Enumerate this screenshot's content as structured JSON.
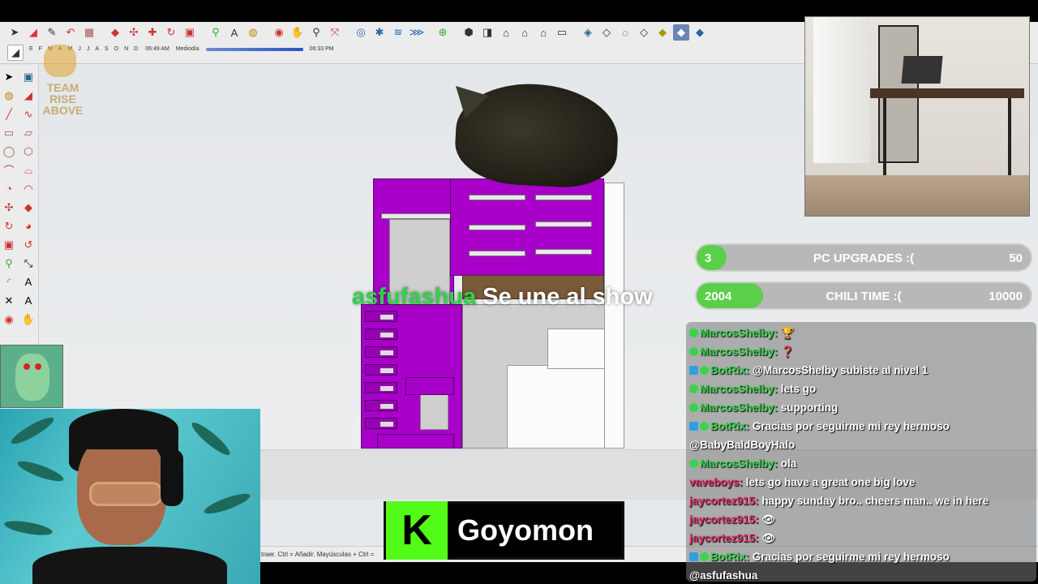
{
  "app": {
    "shadow_bar": {
      "months": [
        "E",
        "F",
        "M",
        "A",
        "M",
        "J",
        "J",
        "A",
        "S",
        "O",
        "N",
        "D"
      ],
      "time_start": "06:49 AM",
      "time_mid": "Mediodía",
      "time_end": "06:33 PM"
    },
    "status_text": "traer. Ctrl = Añadir. Mayúsculas + Ctrl =",
    "team_logo_text": "TEAM RISE ABOVE"
  },
  "overlay": {
    "join": {
      "user": "asfufashua",
      "text": " Se une al show"
    },
    "goals": [
      {
        "current": "3",
        "title": "PC UPGRADES :(",
        "target": "50",
        "progress": 0.06,
        "color": "#5bcf4a"
      },
      {
        "current": "2004",
        "title": "CHILI TIME :(",
        "target": "10000",
        "progress": 0.2,
        "color": "#5bcf4a"
      }
    ],
    "chat": [
      {
        "user": "MarcosShelby",
        "user_color": "#3bd24f",
        "text": " 🏆",
        "badges": [
          "gem"
        ]
      },
      {
        "user": "MarcosShelby",
        "user_color": "#3bd24f",
        "text": " ❓",
        "badges": [
          "gem"
        ]
      },
      {
        "user": "BotRix",
        "user_color": "#3bd24f",
        "text": " @MarcosShelby subiste al nivel 1",
        "badges": [
          "bot",
          "gem"
        ]
      },
      {
        "user": "MarcosShelby",
        "user_color": "#3bd24f",
        "text": " lets go",
        "badges": [
          "gem"
        ]
      },
      {
        "user": "MarcosShelby",
        "user_color": "#3bd24f",
        "text": " supporting",
        "badges": [
          "gem"
        ]
      },
      {
        "user": "BotRix",
        "user_color": "#3bd24f",
        "text": " Gracias por seguirme mi rey hermoso",
        "badges": [
          "bot",
          "gem"
        ]
      },
      {
        "user": "",
        "user_color": "#ffffff",
        "text": "@BabyBaldBoyHalo",
        "badges": []
      },
      {
        "user": "MarcosShelby",
        "user_color": "#3bd24f",
        "text": " ola",
        "badges": [
          "gem"
        ]
      },
      {
        "user": "vaveboys",
        "user_color": "#e0306a",
        "text": " lets go have a great one big love",
        "badges": []
      },
      {
        "user": "jaycortez915",
        "user_color": "#e0306a",
        "text": " happy sunday bro.. cheers man.. we in here",
        "badges": []
      },
      {
        "user": "jaycortez915",
        "user_color": "#e0306a",
        "text": " 👁",
        "badges": []
      },
      {
        "user": "jaycortez915",
        "user_color": "#e0306a",
        "text": " 👁",
        "badges": []
      },
      {
        "user": "BotRix",
        "user_color": "#3bd24f",
        "text": " Gracias por seguirme mi rey hermoso",
        "badges": [
          "bot",
          "gem"
        ]
      },
      {
        "user": "",
        "user_color": "#ffffff",
        "text": "@asfufashua",
        "badges": []
      }
    ],
    "kick": {
      "logo": "K",
      "channel": "Goyomon"
    }
  },
  "colors": {
    "model_magenta": "#a800c8",
    "kick_green": "#53fc18"
  },
  "icons": {
    "toolbar": [
      "select-icon",
      "eraser-icon",
      "paint-icon",
      "line-icon",
      "rectangle-icon",
      "push-pull-icon",
      "move-icon",
      "rotate-icon",
      "scale-icon",
      "tape-icon",
      "text-icon",
      "paint-bucket-icon",
      "orbit-icon",
      "pan-icon",
      "zoom-icon",
      "zoom-extents-icon",
      "section-icon",
      "layers-icon",
      "styles-icon",
      "scenes-icon",
      "components-icon",
      "warehouse-icon",
      "home-icon",
      "shadow-icon",
      "xray-icon",
      "wireframe-icon",
      "hidden-line-icon",
      "shaded-icon",
      "textured-icon",
      "monochrome-icon"
    ]
  }
}
